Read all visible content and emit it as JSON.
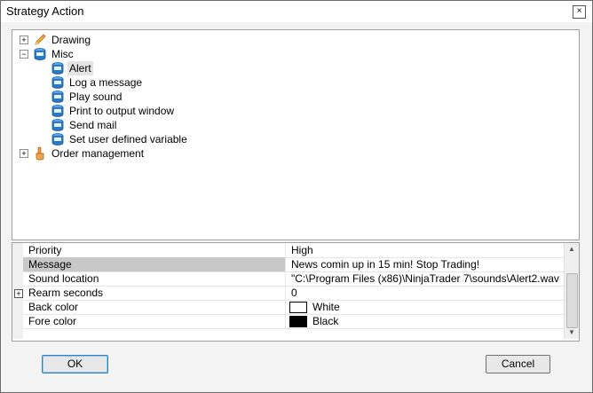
{
  "window": {
    "title": "Strategy Action",
    "close_glyph": "×"
  },
  "tree": {
    "items": [
      {
        "label": "Drawing",
        "icon": "pencil-icon",
        "expander": "+"
      },
      {
        "label": "Misc",
        "icon": "cube-icon",
        "expander": "−"
      },
      {
        "label": "Alert",
        "icon": "cube-icon",
        "selected": true
      },
      {
        "label": "Log a message",
        "icon": "cube-icon"
      },
      {
        "label": "Play sound",
        "icon": "cube-icon"
      },
      {
        "label": "Print to output window",
        "icon": "cube-icon"
      },
      {
        "label": "Send mail",
        "icon": "cube-icon"
      },
      {
        "label": "Set user defined variable",
        "icon": "cube-icon"
      },
      {
        "label": "Order management",
        "icon": "hand-icon",
        "expander": "+"
      }
    ]
  },
  "properties": {
    "rows": [
      {
        "name": "Priority",
        "value": "High"
      },
      {
        "name": "Message",
        "value": "News comin up in 15 min! Stop Trading!"
      },
      {
        "name": "Sound location",
        "value": "\"C:\\Program Files (x86)\\NinjaTrader 7\\sounds\\Alert2.wav"
      },
      {
        "name": "Rearm seconds",
        "value": "0",
        "expander": "+"
      },
      {
        "name": "Back color",
        "value": "White",
        "swatch": "#ffffff"
      },
      {
        "name": "Fore color",
        "value": "Black",
        "swatch": "#000000"
      }
    ]
  },
  "buttons": {
    "ok": "OK",
    "cancel": "Cancel"
  }
}
